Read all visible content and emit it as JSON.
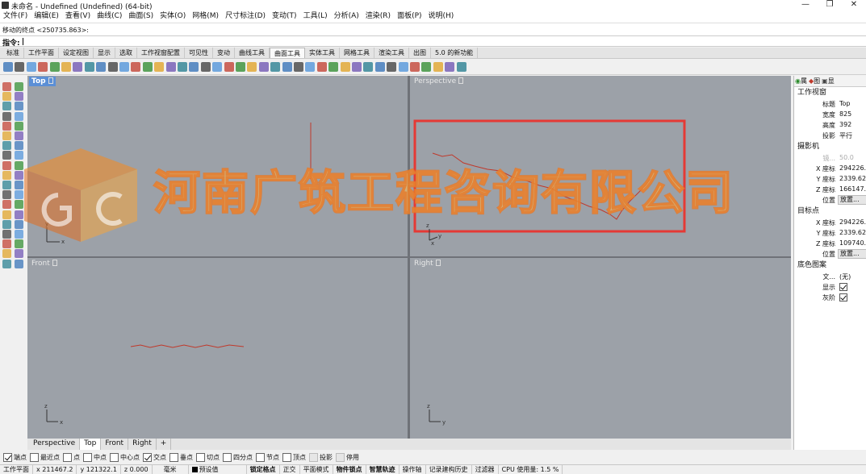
{
  "window": {
    "title": "未命名 - Undefined (Undefined) (64-bit)",
    "controls": {
      "minimize": "—",
      "maximize": "❐",
      "close": "✕"
    }
  },
  "menu": [
    "文件(F)",
    "编辑(E)",
    "查看(V)",
    "曲线(C)",
    "曲面(S)",
    "实体(O)",
    "网格(M)",
    "尺寸标注(D)",
    "变动(T)",
    "工具(L)",
    "分析(A)",
    "渲染(R)",
    "面板(P)",
    "说明(H)"
  ],
  "command": {
    "history": "移动的终点 <250735.863>:",
    "prompt": "指令:"
  },
  "toolbar_tabs": [
    {
      "label": "标准",
      "active": false
    },
    {
      "label": "工作平面",
      "active": false
    },
    {
      "label": "设定视图",
      "active": false
    },
    {
      "label": "显示",
      "active": false
    },
    {
      "label": "选取",
      "active": false
    },
    {
      "label": "工作视窗配置",
      "active": false
    },
    {
      "label": "可见性",
      "active": false
    },
    {
      "label": "变动",
      "active": false
    },
    {
      "label": "曲线工具",
      "active": false
    },
    {
      "label": "曲面工具",
      "active": true
    },
    {
      "label": "实体工具",
      "active": false
    },
    {
      "label": "网格工具",
      "active": false
    },
    {
      "label": "渲染工具",
      "active": false
    },
    {
      "label": "出图",
      "active": false
    },
    {
      "label": "5.0 的新功能",
      "active": false
    }
  ],
  "viewports": {
    "top": {
      "label": "Top",
      "active": true
    },
    "perspective": {
      "label": "Perspective"
    },
    "front": {
      "label": "Front"
    },
    "right": {
      "label": "Right"
    }
  },
  "axis": {
    "x": "x",
    "y": "y",
    "z": "z"
  },
  "viewport_tabs": [
    {
      "label": "Perspective",
      "active": false
    },
    {
      "label": "Top",
      "active": true
    },
    {
      "label": "Front",
      "active": false
    },
    {
      "label": "Right",
      "active": false
    },
    {
      "label": "+",
      "active": false
    }
  ],
  "panel": {
    "tabs": [
      "属",
      "图",
      "显"
    ],
    "viewport_section": "工作视窗",
    "viewport_props": [
      {
        "label": "标题",
        "value": "Top"
      },
      {
        "label": "宽度",
        "value": "825"
      },
      {
        "label": "高度",
        "value": "392"
      },
      {
        "label": "投影",
        "value": "平行"
      }
    ],
    "camera_section": "摄影机",
    "camera_props": [
      {
        "label": "镜...",
        "value": "50.0"
      },
      {
        "label": "X 座标",
        "value": "294226."
      },
      {
        "label": "Y 座标",
        "value": "2339.62"
      },
      {
        "label": "Z 座标",
        "value": "166147."
      },
      {
        "label": "位置",
        "value": "放置..."
      }
    ],
    "target_section": "目标点",
    "target_props": [
      {
        "label": "X 座标",
        "value": "294226."
      },
      {
        "label": "Y 座标",
        "value": "2339.62"
      },
      {
        "label": "Z 座标",
        "value": "109740."
      },
      {
        "label": "位置",
        "value": "放置..."
      }
    ],
    "wallpaper_section": "底色图案",
    "wallpaper_props": [
      {
        "label": "文...",
        "value": "(无)"
      },
      {
        "label": "显示",
        "value": ""
      },
      {
        "label": "灰阶",
        "value": ""
      }
    ]
  },
  "osnaps": [
    {
      "label": "端点",
      "checked": true
    },
    {
      "label": "最近点",
      "checked": false
    },
    {
      "label": "点",
      "checked": false
    },
    {
      "label": "中点",
      "checked": false
    },
    {
      "label": "中心点",
      "checked": false
    },
    {
      "label": "交点",
      "checked": true
    },
    {
      "label": "垂点",
      "checked": false
    },
    {
      "label": "切点",
      "checked": false
    },
    {
      "label": "四分点",
      "checked": false
    },
    {
      "label": "节点",
      "checked": false
    },
    {
      "label": "顶点",
      "checked": false
    },
    {
      "label": "投影",
      "checked": false,
      "disabled": true
    },
    {
      "label": "停用",
      "checked": false,
      "disabled": true
    }
  ],
  "status": {
    "cplane": "工作平面",
    "x": "x 211467.2",
    "y": "y 121322.1",
    "z": "z 0.000",
    "unit": "毫米",
    "layer": "预设值",
    "items": [
      {
        "label": "锁定格点",
        "bold": true
      },
      {
        "label": "正交",
        "bold": false
      },
      {
        "label": "平面模式",
        "bold": false
      },
      {
        "label": "物件锁点",
        "bold": true
      },
      {
        "label": "智慧轨迹",
        "bold": true
      },
      {
        "label": "操作轴",
        "bold": false
      },
      {
        "label": "记录建构历史",
        "bold": false
      },
      {
        "label": "过滤器",
        "bold": false
      },
      {
        "label": "CPU 使用量: 1.5 %",
        "bold": false
      }
    ]
  },
  "watermark": {
    "text": "河南广筑工程咨询有限公司"
  },
  "colors": {
    "viewport_bg": "#9ca1a8",
    "active_label": "#5b8fd6",
    "curve": "#c0392b",
    "highlight_box": "#e53935"
  }
}
